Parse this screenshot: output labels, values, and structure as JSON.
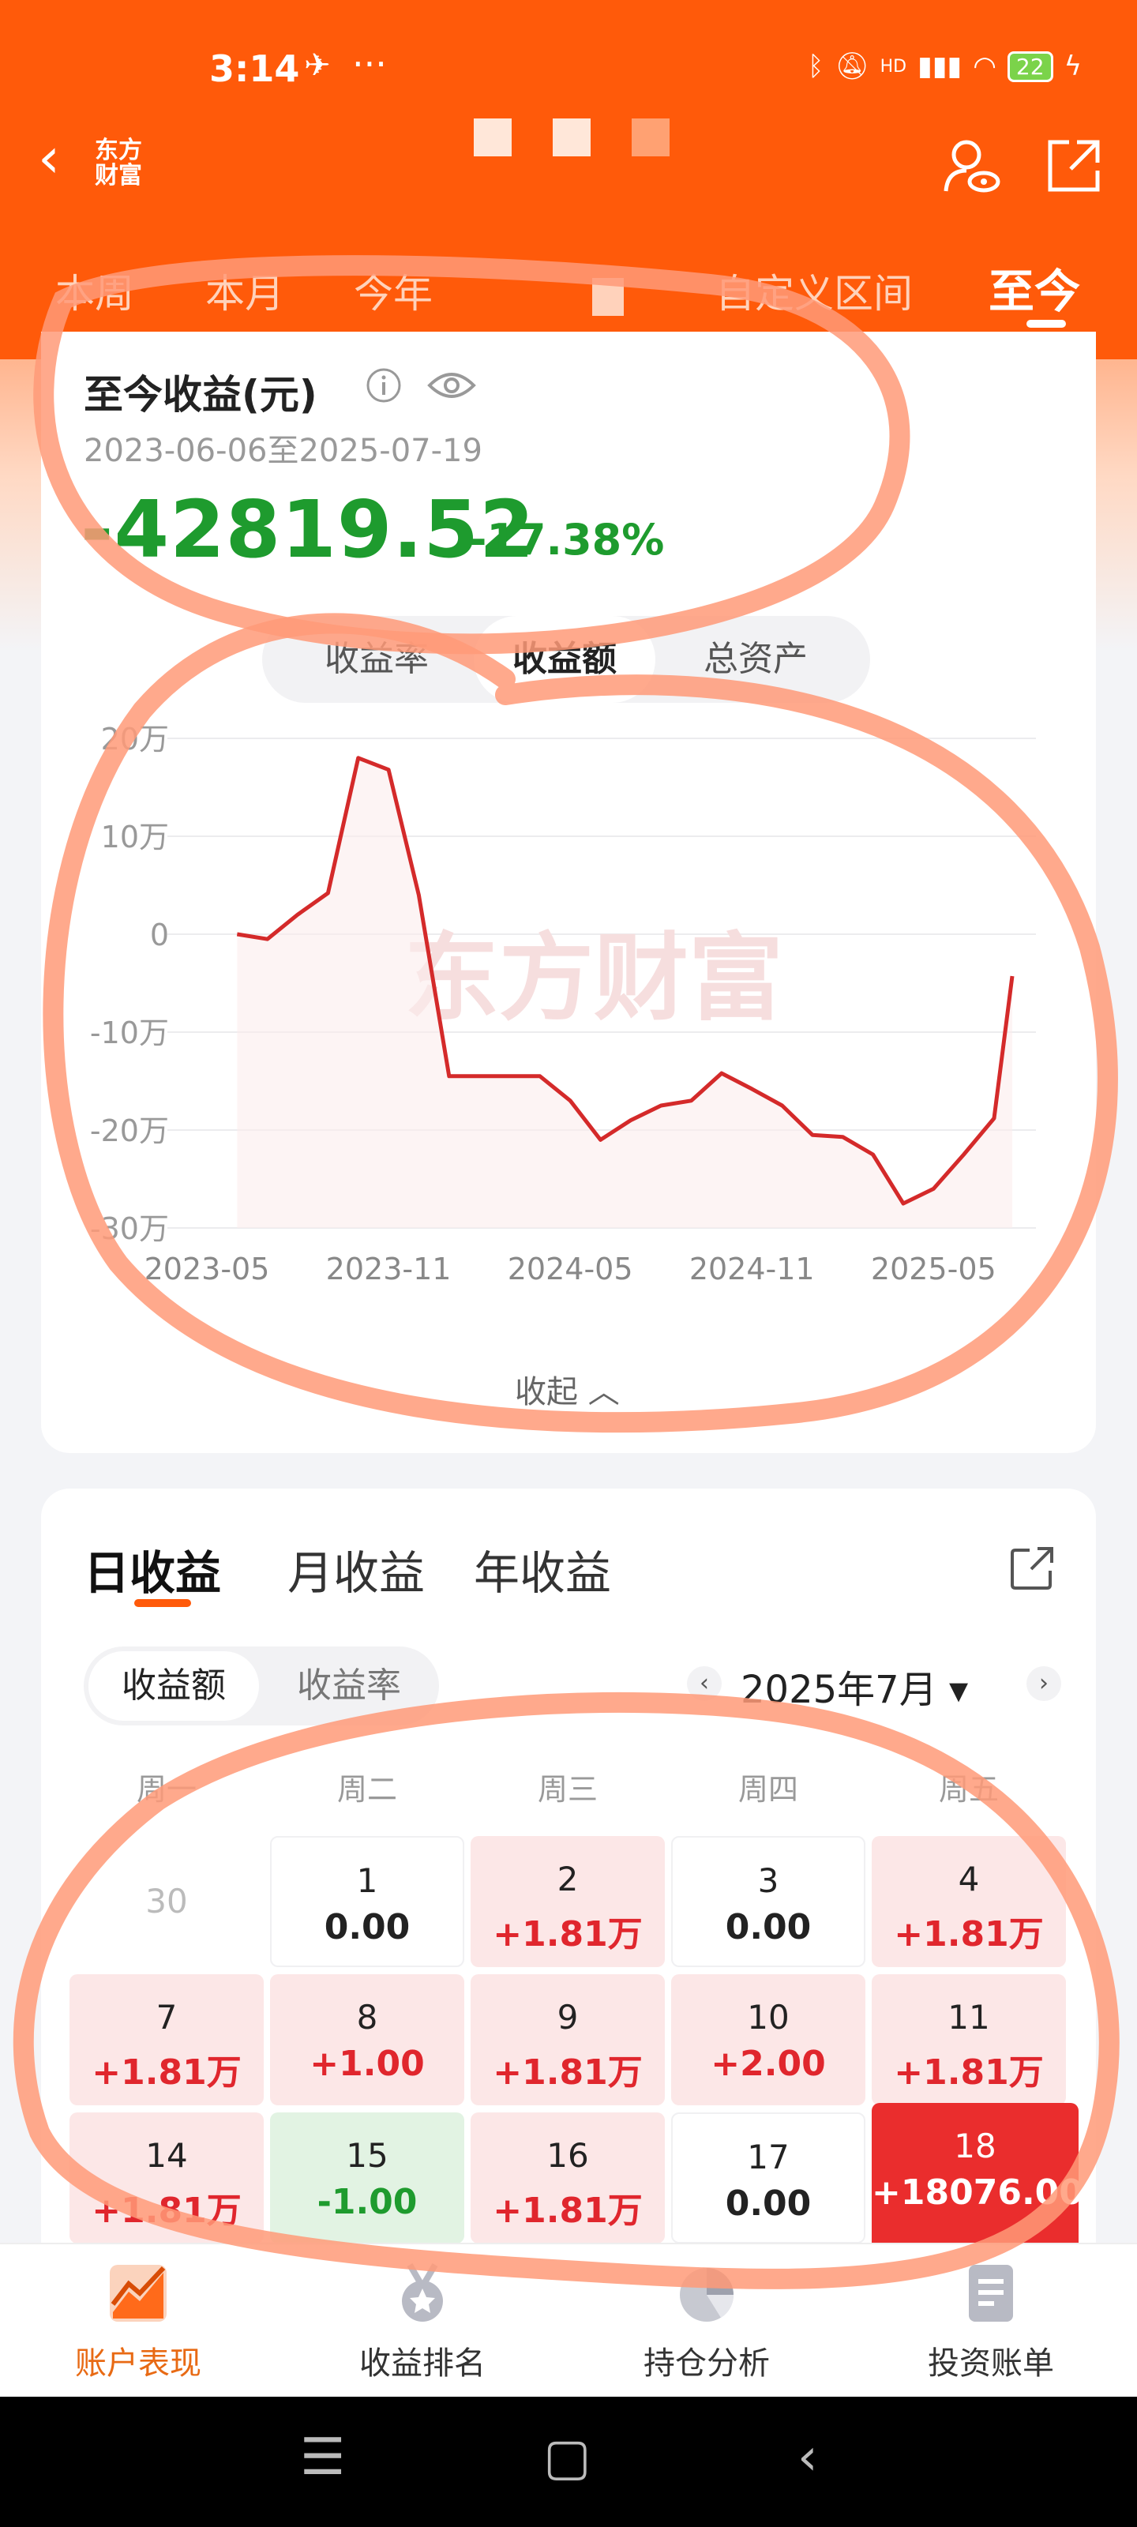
{
  "status_bar": {
    "time": "3:14",
    "dots": "···",
    "network": "HD",
    "battery": "22"
  },
  "header": {
    "back_label": "‹",
    "logo_text": "东方\n财富",
    "tabs": [
      {
        "label": "本周"
      },
      {
        "label": "本月"
      },
      {
        "label": "今年"
      },
      {
        "label": "自定义区间"
      },
      {
        "label": "至今"
      }
    ]
  },
  "summary": {
    "title": "至今收益(元)",
    "date_range": "2023-06-06至2025-07-19",
    "value": "-42819.52",
    "percent": "-17.38%",
    "segments": [
      "收益率",
      "收益额",
      "总资产"
    ],
    "collapse_label": "收起 ︿"
  },
  "chart_data": {
    "type": "line",
    "watermark": "东方财富",
    "x_tick_labels": [
      "2023-05",
      "2023-11",
      "2024-05",
      "2024-11",
      "2025-05"
    ],
    "y_tick_labels": [
      "20万",
      "10万",
      "0",
      "-10万",
      "-20万",
      "-30万"
    ],
    "y_ticks": [
      200000,
      100000,
      0,
      -100000,
      -200000,
      -300000
    ],
    "ylim": [
      -300000,
      200000
    ],
    "x_range": [
      "2023-05",
      "2025-07"
    ],
    "series": [
      {
        "color": "#d42a2a",
        "points": [
          [
            "2023-06",
            0
          ],
          [
            "2023-07",
            -5000
          ],
          [
            "2023-08",
            20000
          ],
          [
            "2023-09",
            42000
          ],
          [
            "2023-10",
            180000
          ],
          [
            "2023-11",
            168000
          ],
          [
            "2023-12",
            40000
          ],
          [
            "2024-01",
            -145000
          ],
          [
            "2024-02",
            -145000
          ],
          [
            "2024-03",
            -145000
          ],
          [
            "2024-04",
            -145000
          ],
          [
            "2024-05",
            -170000
          ],
          [
            "2024-06",
            -210000
          ],
          [
            "2024-07",
            -190000
          ],
          [
            "2024-08",
            -175000
          ],
          [
            "2024-09",
            -170000
          ],
          [
            "2024-10",
            -142000
          ],
          [
            "2024-11",
            -158000
          ],
          [
            "2024-12",
            -175000
          ],
          [
            "2025-01",
            -205000
          ],
          [
            "2025-02",
            -207000
          ],
          [
            "2025-03",
            -225000
          ],
          [
            "2025-04",
            -275000
          ],
          [
            "2025-05",
            -260000
          ],
          [
            "2025-06",
            -225000
          ],
          [
            "2025-07",
            -188000
          ],
          [
            "2025-07-19",
            -42800
          ]
        ]
      }
    ],
    "grid": true
  },
  "daily": {
    "tabs": [
      "日收益",
      "月收益",
      "年收益"
    ],
    "segments": [
      "收益额",
      "收益率"
    ],
    "month_label": "2025年7月 ▾",
    "prev": "‹",
    "next": "›",
    "weekdays": [
      "周一",
      "周二",
      "周三",
      "周四",
      "周五"
    ],
    "cells": [
      {
        "day": "30",
        "value": "",
        "style": "grey"
      },
      {
        "day": "1",
        "value": "0.00",
        "style": "white"
      },
      {
        "day": "2",
        "value": "+1.81万",
        "style": "pink"
      },
      {
        "day": "3",
        "value": "0.00",
        "style": "white"
      },
      {
        "day": "4",
        "value": "+1.81万",
        "style": "pink"
      },
      {
        "day": "7",
        "value": "+1.81万",
        "style": "pink"
      },
      {
        "day": "8",
        "value": "+1.00",
        "style": "pink"
      },
      {
        "day": "9",
        "value": "+1.81万",
        "style": "pink"
      },
      {
        "day": "10",
        "value": "+2.00",
        "style": "pink"
      },
      {
        "day": "11",
        "value": "+1.81万",
        "style": "pink"
      },
      {
        "day": "14",
        "value": "+1.81万",
        "style": "pink"
      },
      {
        "day": "15",
        "value": "-1.00",
        "style": "green"
      },
      {
        "day": "16",
        "value": "+1.81万",
        "style": "pink"
      },
      {
        "day": "17",
        "value": "0.00",
        "style": "white"
      },
      {
        "day": "18",
        "value": "+18076.00",
        "style": "red"
      }
    ]
  },
  "bottom_nav": [
    {
      "label": "账户表现",
      "icon": "chart-trend-icon",
      "active": true
    },
    {
      "label": "收益排名",
      "icon": "medal-icon",
      "active": false
    },
    {
      "label": "持仓分析",
      "icon": "pie-chart-icon",
      "active": false
    },
    {
      "label": "投资账单",
      "icon": "bill-icon",
      "active": false
    }
  ],
  "system_nav": [
    "☰",
    "▢",
    "‹"
  ],
  "colors": {
    "brand": "#ff5a0a",
    "loss": "#1e9b2e",
    "gain": "#e0262d",
    "highlight": "#ea2d2d"
  }
}
